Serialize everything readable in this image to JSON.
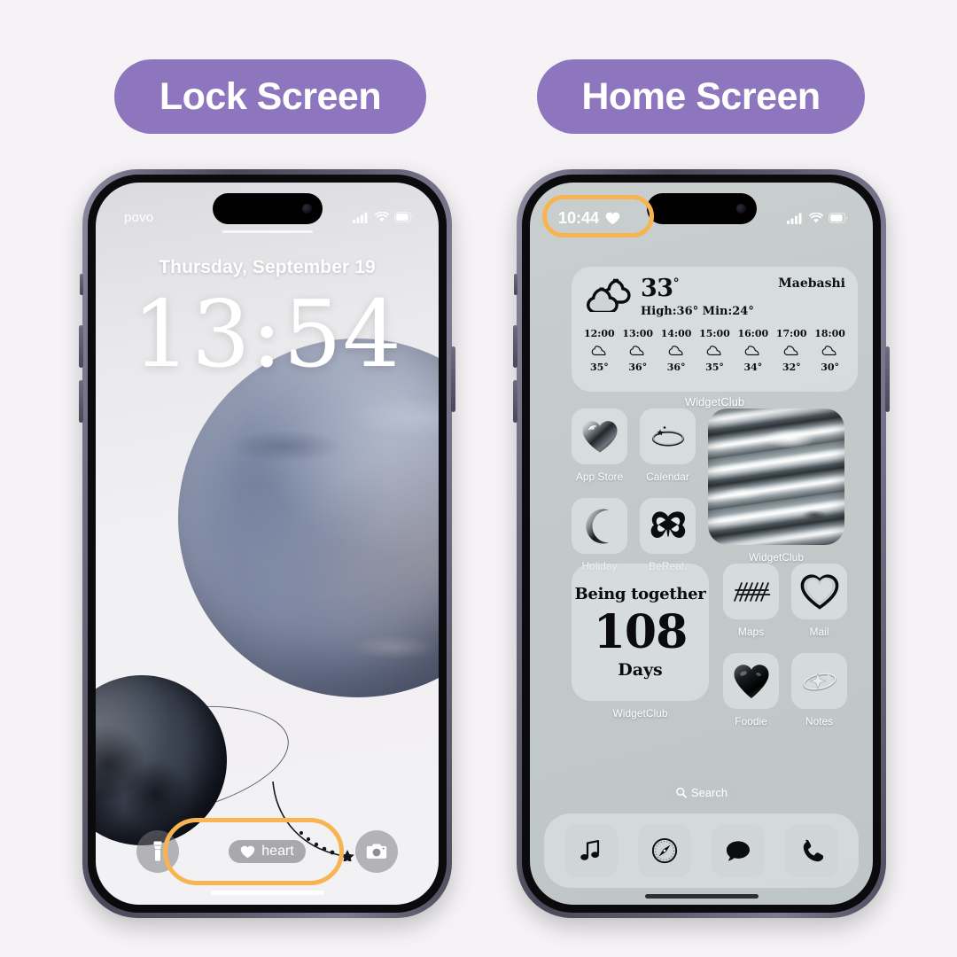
{
  "page": {
    "background_color": "#F5F3F5",
    "accent_purple": "#8E76BF",
    "highlight_orange": "#F8B451"
  },
  "badges": {
    "lock": "Lock Screen",
    "home": "Home Screen"
  },
  "lock_screen": {
    "status_bar": {
      "carrier": "povo",
      "signal_icon": "cellular-signal-icon",
      "wifi_icon": "wifi-icon",
      "battery_icon": "battery-icon"
    },
    "date": "Thursday, September 19",
    "time": "13:54",
    "bottom_controls": {
      "flashlight_icon": "flashlight-icon",
      "camera_icon": "camera-icon",
      "widget_pill": {
        "icon": "heart-icon",
        "label": "heart"
      }
    },
    "wallpaper": "planet-and-moon-space-wallpaper"
  },
  "home_screen": {
    "status_bar": {
      "time": "10:44",
      "heart_icon": "heart-icon",
      "signal_icon": "cellular-signal-icon",
      "wifi_icon": "wifi-icon",
      "battery_icon": "battery-icon"
    },
    "weather_widget": {
      "condition_icon": "cloud-icon",
      "temperature": "33",
      "degree": "°",
      "high_low": "High:36° Min:24°",
      "city": "Maebashi",
      "hourly": [
        {
          "time": "12:00",
          "icon": "cloud-icon",
          "temp": "35°"
        },
        {
          "time": "13:00",
          "icon": "cloud-icon",
          "temp": "36°"
        },
        {
          "time": "14:00",
          "icon": "cloud-icon",
          "temp": "36°"
        },
        {
          "time": "15:00",
          "icon": "cloud-icon",
          "temp": "35°"
        },
        {
          "time": "16:00",
          "icon": "cloud-icon",
          "temp": "34°"
        },
        {
          "time": "17:00",
          "icon": "cloud-icon",
          "temp": "32°"
        },
        {
          "time": "18:00",
          "icon": "cloud-icon",
          "temp": "30°"
        }
      ],
      "caption": "WidgetClub"
    },
    "apps_upper": [
      {
        "label": "App Store",
        "icon": "chrome-heart-icon"
      },
      {
        "label": "Calendar",
        "icon": "ring-icon"
      },
      {
        "label": "Holiday",
        "icon": "crescent-moon-icon"
      },
      {
        "label": "BeReal.",
        "icon": "butterfly-icon"
      }
    ],
    "marble_widget": {
      "caption": "WidgetClub",
      "icon": "marble-texture-widget"
    },
    "together_widget": {
      "title": "Being together",
      "count": "108",
      "unit": "Days",
      "caption": "WidgetClub"
    },
    "apps_lower": [
      {
        "label": "Maps",
        "icon": "lightning-bolts-icon"
      },
      {
        "label": "Mail",
        "icon": "heart-outline-icon"
      },
      {
        "label": "Foodie",
        "icon": "black-heart-icon"
      },
      {
        "label": "Notes",
        "icon": "ring-star-icon"
      }
    ],
    "search": {
      "icon": "search-icon",
      "label": "Search"
    },
    "dock": [
      {
        "label": "Music",
        "icon": "music-note-icon"
      },
      {
        "label": "Safari",
        "icon": "compass-icon"
      },
      {
        "label": "Messages",
        "icon": "speech-bubble-icon"
      },
      {
        "label": "Phone",
        "icon": "phone-handset-icon"
      }
    ]
  }
}
